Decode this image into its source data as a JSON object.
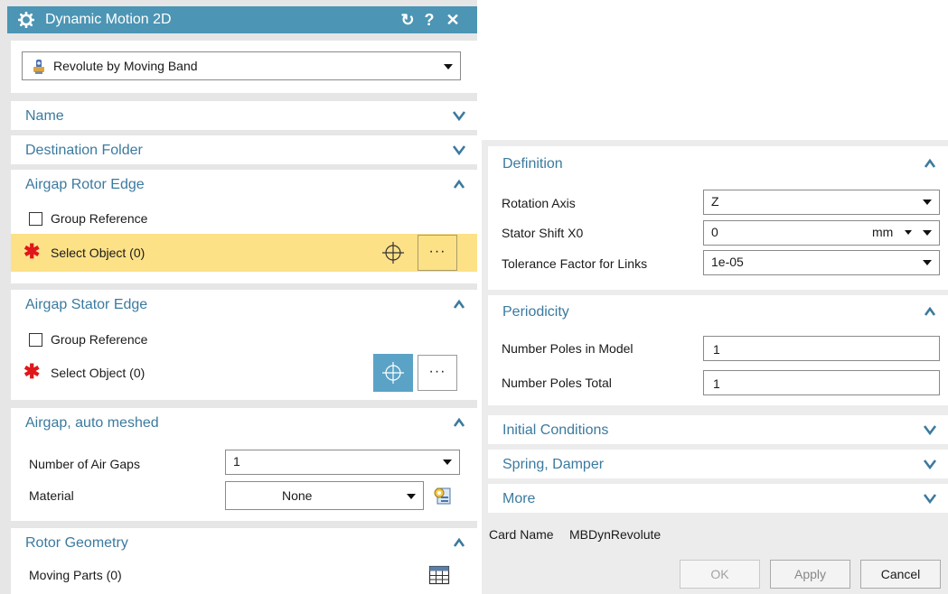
{
  "window": {
    "title": "Dynamic Motion 2D",
    "reset_glyph": "↻",
    "help_glyph": "?",
    "close_glyph": "✕"
  },
  "type_selector": {
    "value": "Revolute by Moving Band",
    "icon": "revolute-joint-icon"
  },
  "sections_left": {
    "name": "Name",
    "destination_folder": "Destination Folder",
    "rotor_edge": {
      "title": "Airgap Rotor Edge",
      "group_reference": "Group Reference",
      "select_object": "Select Object (0)",
      "more": "···"
    },
    "stator_edge": {
      "title": "Airgap Stator Edge",
      "group_reference": "Group Reference",
      "select_object": "Select Object (0)",
      "more": "···"
    },
    "airgap": {
      "title": "Airgap, auto meshed",
      "num_gaps_label": "Number of Air Gaps",
      "num_gaps_value": "1",
      "material_label": "Material",
      "material_value": "None"
    },
    "rotor_geometry": {
      "title": "Rotor Geometry",
      "moving_parts": "Moving Parts (0)"
    }
  },
  "sections_right": {
    "definition": {
      "title": "Definition",
      "rotation_axis_label": "Rotation Axis",
      "rotation_axis_value": "Z",
      "stator_shift_label": "Stator Shift X0",
      "stator_shift_value": "0",
      "stator_shift_unit": "mm",
      "tolerance_label": "Tolerance Factor for Links",
      "tolerance_value": "1e-05"
    },
    "periodicity": {
      "title": "Periodicity",
      "poles_model_label": "Number Poles in Model",
      "poles_model_value": "1",
      "poles_total_label": "Number Poles Total",
      "poles_total_value": "1"
    },
    "initial_conditions": "Initial Conditions",
    "spring_damper": "Spring, Damper",
    "more": "More"
  },
  "card_name": {
    "label": "Card Name",
    "value": "MBDynRevolute"
  },
  "buttons": {
    "ok": "OK",
    "apply": "Apply",
    "cancel": "Cancel"
  },
  "colors": {
    "title_bar": "#4c95b4",
    "section_title": "#3b7a9f",
    "highlight": "#fce187",
    "active_button": "#5aa3c6",
    "required_star": "#e0161a"
  }
}
